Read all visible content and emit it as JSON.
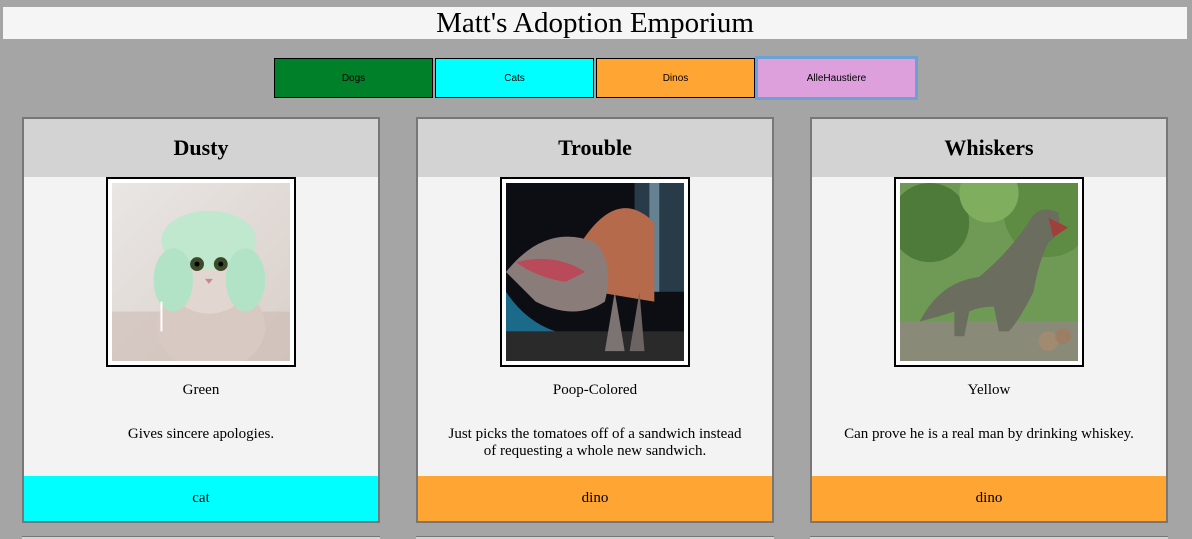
{
  "page": {
    "title": "Matt's Adoption Emporium"
  },
  "filters": [
    {
      "label": "Dogs",
      "color": "#008028"
    },
    {
      "label": "Cats",
      "color": "#00ffff"
    },
    {
      "label": "Dinos",
      "color": "#ffa534"
    },
    {
      "label": "AlleHaustiere",
      "color": "#dda0dd"
    }
  ],
  "pets": [
    {
      "name": "Dusty",
      "color": "Green",
      "description": "Gives sincere apologies.",
      "type": "cat",
      "type_color": "#00ffff",
      "photo": "cat-in-knit-hat"
    },
    {
      "name": "Trouble",
      "color": "Poop-Colored",
      "description": "Just picks the tomatoes off of a sandwich instead of requesting a whole new sandwich.",
      "type": "dino",
      "type_color": "#ffa534",
      "photo": "spinosaurus-model"
    },
    {
      "name": "Whiskers",
      "color": "Yellow",
      "description": "Can prove he is a real man by drinking whiskey.",
      "type": "dino",
      "type_color": "#ffa534",
      "photo": "t-rex-in-forest"
    }
  ]
}
